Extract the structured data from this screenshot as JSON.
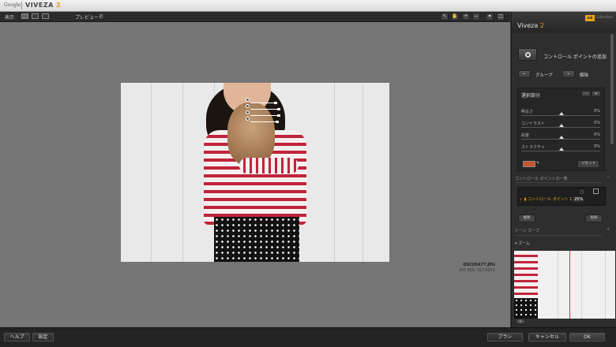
{
  "titlebar": {
    "brand": "Google",
    "app_name": "VIVEZA",
    "app_version": "2"
  },
  "toolbar": {
    "view_label": "表示",
    "preview_label": "プレビュー :"
  },
  "photo": {
    "filename": "DSC05477.JPG",
    "exif": "ISO 400, SLT-A65V"
  },
  "panel": {
    "title": "Viveza",
    "title_version": "2",
    "nik_logo": "nik",
    "collection": "Collection",
    "add_control_point": "コントロール ポイントの追加",
    "group": "グループ",
    "ungroup": "解除",
    "selection_header": "選択部分",
    "sliders": [
      {
        "name": "明るさ",
        "value": "0%"
      },
      {
        "name": "コントラスト",
        "value": "0%"
      },
      {
        "name": "彩度",
        "value": "0%"
      },
      {
        "name": "ストラクチャ",
        "value": "0%"
      }
    ],
    "reset": "リセット",
    "cp_list_header": "コントロール ポイントの一覧",
    "cp_item": "コントロール ポイント 1",
    "cp_item_value": "25%",
    "duplicate": "複製",
    "delete": "削除",
    "tone_curve": "トーン カーブ",
    "zoom": "ズーム"
  },
  "bottom": {
    "help": "ヘルプ",
    "settings": "設定",
    "brush": "ブラシ",
    "cancel": "キャンセル",
    "ok": "OK"
  },
  "colors": {
    "accent": "#e89a1b",
    "swatch": "#c9542f"
  }
}
